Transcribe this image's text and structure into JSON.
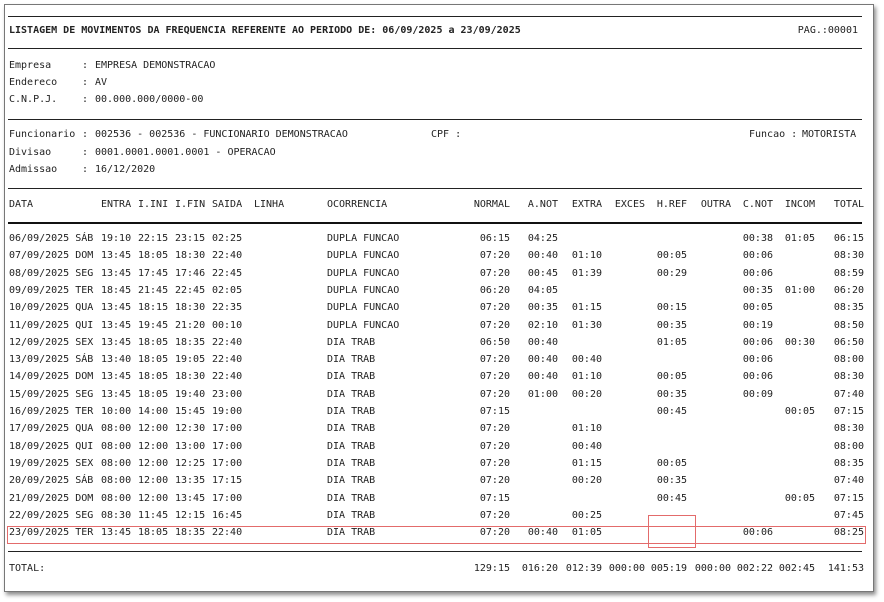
{
  "header": {
    "title": "LISTAGEM DE MOVIMENTOS DA FREQUENCIA REFERENTE AO PERIODO DE: 06/09/2025 a 23/09/2025",
    "page": "PAG.:00001"
  },
  "company": [
    {
      "label": "Empresa",
      "value": "EMPRESA DEMONSTRACAO"
    },
    {
      "label": "Endereco",
      "value": "AV"
    },
    {
      "label": "C.N.P.J.",
      "value": "00.000.000/0000-00"
    }
  ],
  "employee": {
    "funcionario_label": "Funcionario",
    "funcionario": "002536 - 002536 - FUNCIONARIO DEMONSTRACAO",
    "cpf_label": "CPF :",
    "funcao_label": "Funcao :",
    "funcao": "MOTORISTA",
    "divisao_label": "Divisao",
    "divisao": "0001.0001.0001.0001 - OPERACAO",
    "admissao_label": "Admissao",
    "admissao": "16/12/2020"
  },
  "columns": [
    "DATA",
    "ENTRA",
    "I.INI",
    "I.FIN",
    "SAIDA",
    "LINHA",
    "OCORRENCIA",
    "NORMAL",
    "A.NOT",
    "EXTRA",
    "EXCES",
    "H.REF",
    "OUTRA",
    "C.NOT",
    "INCOM",
    "TOTAL"
  ],
  "rows": [
    [
      "06/09/2025 SÁB",
      "19:10",
      "22:15",
      "23:15",
      "02:25",
      "",
      "DUPLA FUNCAO",
      "06:15",
      "04:25",
      "",
      "",
      "",
      "",
      "00:38",
      "01:05",
      "06:15"
    ],
    [
      "07/09/2025 DOM",
      "13:45",
      "18:05",
      "18:30",
      "22:40",
      "",
      "DUPLA FUNCAO",
      "07:20",
      "00:40",
      "01:10",
      "",
      "00:05",
      "",
      "00:06",
      "",
      "08:30"
    ],
    [
      "08/09/2025 SEG",
      "13:45",
      "17:45",
      "17:46",
      "22:45",
      "",
      "DUPLA FUNCAO",
      "07:20",
      "00:45",
      "01:39",
      "",
      "00:29",
      "",
      "00:06",
      "",
      "08:59"
    ],
    [
      "09/09/2025 TER",
      "18:45",
      "21:45",
      "22:45",
      "02:05",
      "",
      "DUPLA FUNCAO",
      "06:20",
      "04:05",
      "",
      "",
      "",
      "",
      "00:35",
      "01:00",
      "06:20"
    ],
    [
      "10/09/2025 QUA",
      "13:45",
      "18:15",
      "18:30",
      "22:35",
      "",
      "DUPLA FUNCAO",
      "07:20",
      "00:35",
      "01:15",
      "",
      "00:15",
      "",
      "00:05",
      "",
      "08:35"
    ],
    [
      "11/09/2025 QUI",
      "13:45",
      "19:45",
      "21:20",
      "00:10",
      "",
      "DUPLA FUNCAO",
      "07:20",
      "02:10",
      "01:30",
      "",
      "00:35",
      "",
      "00:19",
      "",
      "08:50"
    ],
    [
      "12/09/2025 SEX",
      "13:45",
      "18:05",
      "18:35",
      "22:40",
      "",
      "DIA TRAB",
      "06:50",
      "00:40",
      "",
      "",
      "01:05",
      "",
      "00:06",
      "00:30",
      "06:50"
    ],
    [
      "13/09/2025 SÁB",
      "13:40",
      "18:05",
      "19:05",
      "22:40",
      "",
      "DIA TRAB",
      "07:20",
      "00:40",
      "00:40",
      "",
      "",
      "",
      "00:06",
      "",
      "08:00"
    ],
    [
      "14/09/2025 DOM",
      "13:45",
      "18:05",
      "18:30",
      "22:40",
      "",
      "DIA TRAB",
      "07:20",
      "00:40",
      "01:10",
      "",
      "00:05",
      "",
      "00:06",
      "",
      "08:30"
    ],
    [
      "15/09/2025 SEG",
      "13:45",
      "18:05",
      "19:40",
      "23:00",
      "",
      "DIA TRAB",
      "07:20",
      "01:00",
      "00:20",
      "",
      "00:35",
      "",
      "00:09",
      "",
      "07:40"
    ],
    [
      "16/09/2025 TER",
      "10:00",
      "14:00",
      "15:45",
      "19:00",
      "",
      "DIA TRAB",
      "07:15",
      "",
      "",
      "",
      "00:45",
      "",
      "",
      "00:05",
      "07:15"
    ],
    [
      "17/09/2025 QUA",
      "08:00",
      "12:00",
      "12:30",
      "17:00",
      "",
      "DIA TRAB",
      "07:20",
      "",
      "01:10",
      "",
      "",
      "",
      "",
      "",
      "08:30"
    ],
    [
      "18/09/2025 QUI",
      "08:00",
      "12:00",
      "13:00",
      "17:00",
      "",
      "DIA TRAB",
      "07:20",
      "",
      "00:40",
      "",
      "",
      "",
      "",
      "",
      "08:00"
    ],
    [
      "19/09/2025 SEX",
      "08:00",
      "12:00",
      "12:25",
      "17:00",
      "",
      "DIA TRAB",
      "07:20",
      "",
      "01:15",
      "",
      "00:05",
      "",
      "",
      "",
      "08:35"
    ],
    [
      "20/09/2025 SÁB",
      "08:00",
      "12:00",
      "13:35",
      "17:15",
      "",
      "DIA TRAB",
      "07:20",
      "",
      "00:20",
      "",
      "00:35",
      "",
      "",
      "",
      "07:40"
    ],
    [
      "21/09/2025 DOM",
      "08:00",
      "12:00",
      "13:45",
      "17:00",
      "",
      "DIA TRAB",
      "07:15",
      "",
      "",
      "",
      "00:45",
      "",
      "",
      "00:05",
      "07:15"
    ],
    [
      "22/09/2025 SEG",
      "08:30",
      "11:45",
      "12:15",
      "16:45",
      "",
      "DIA TRAB",
      "07:20",
      "",
      "00:25",
      "",
      "",
      "",
      "",
      "",
      "07:45"
    ],
    [
      "23/09/2025 TER",
      "13:45",
      "18:05",
      "18:35",
      "22:40",
      "",
      "DIA TRAB",
      "07:20",
      "00:40",
      "01:05",
      "",
      "",
      "",
      "00:06",
      "",
      "08:25"
    ]
  ],
  "totals": {
    "label": "TOTAL:",
    "values": [
      "129:15",
      "016:20",
      "012:39",
      "000:00",
      "005:19",
      "000:00",
      "002:22",
      "002:45",
      "141:53"
    ]
  },
  "colors": {
    "highlight": "#e36b6b"
  }
}
